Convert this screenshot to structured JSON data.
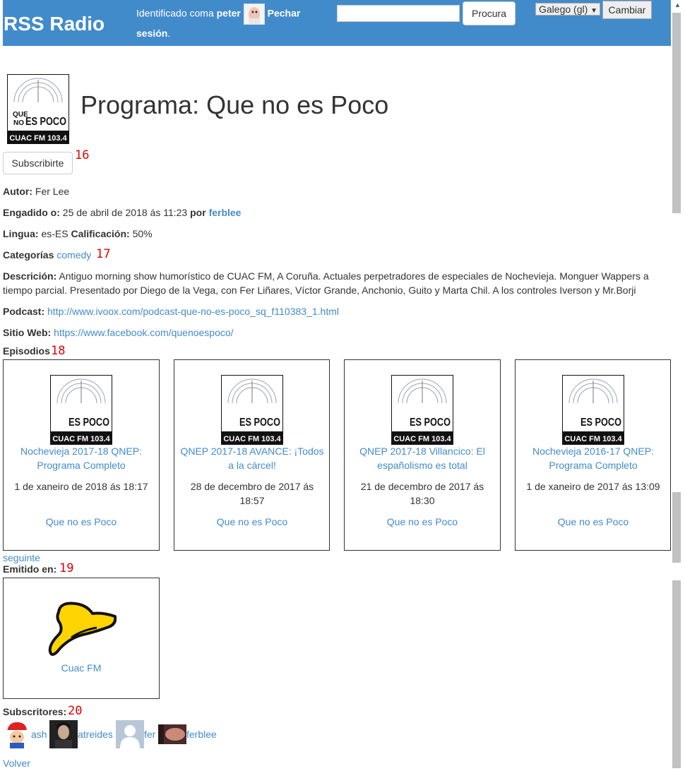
{
  "header": {
    "brand": "RSS Radio",
    "identified_as": "Identificado coma",
    "username": "peter",
    "logout": "Pechar sesión",
    "search_button": "Procura",
    "language": "Galego (gl)",
    "change_button": "Cambiar"
  },
  "program": {
    "title": "Programa: Que no es Poco",
    "subscribe_button": "Subscribirte",
    "markers": [
      "16",
      "17",
      "18",
      "19",
      "20"
    ],
    "author_label": "Autor:",
    "author": "Fer Lee",
    "added_label": "Engadido o:",
    "added": "25 de abril de 2018 ás 11:23",
    "by_label": "por",
    "added_by": "ferblee",
    "language_label": "Lingua:",
    "language": "es-ES",
    "rating_label": "Calificación:",
    "rating": "50%",
    "categories_label": "Categorías",
    "category": "comedy",
    "description_label": "Descrición:",
    "description": "Antiguo morning show humorístico de CUAC FM, A Coruña. Actuales perpetradores de especiales de Nochevieja. Monguer Wappers a tiempo parcial. Presentado por Diego de la Vega, con Fer Liñares, Víctor Grande, Anchonio, Guito y Marta Chil. A los controles Iverson y Mr.Borji",
    "podcast_label": "Podcast:",
    "podcast_url": "http://www.ivoox.com/podcast-que-no-es-poco_sq_f110383_1.html",
    "website_label": "Sitio Web:",
    "website_url": "https://www.facebook.com/quenoespoco/",
    "logo_text": {
      "line1": "QUE",
      "line2": "NO",
      "big": "ES POCO",
      "footer": "CUAC FM 103.4"
    }
  },
  "episodes": {
    "label": "Episodios",
    "items": [
      {
        "title": "Nochevieja 2017-18 QNEP: Programa Completo",
        "date": "1 de xaneiro de 2018 ás 18:17",
        "program": "Que no es Poco"
      },
      {
        "title": "QNEP 2017-18 AVANCE: ¡Todos a la cárcel!",
        "date": "28 de decembro de 2017 ás 18:57",
        "program": "Que no es Poco"
      },
      {
        "title": "QNEP 2017-18 Villancico: El españolismo es total",
        "date": "21 de decembro de 2017 ás 18:30",
        "program": "Que no es Poco"
      },
      {
        "title": "Nochevieja 2016-17 QNEP: Programa Completo",
        "date": "1 de xaneiro de 2017 ás 13:09",
        "program": "Que no es Poco"
      }
    ],
    "next": "seguinte"
  },
  "broadcast": {
    "label": "Emitido en:",
    "station": "Cuac FM"
  },
  "subscribers": {
    "label": "Subscritores:",
    "users": [
      {
        "name": "ash"
      },
      {
        "name": "atreides"
      },
      {
        "name": "fer"
      },
      {
        "name": "ferblee"
      }
    ]
  },
  "back": "Volver",
  "colors": {
    "header_bg": "#428bca",
    "link": "#428bca",
    "marker": "#dd0000"
  }
}
